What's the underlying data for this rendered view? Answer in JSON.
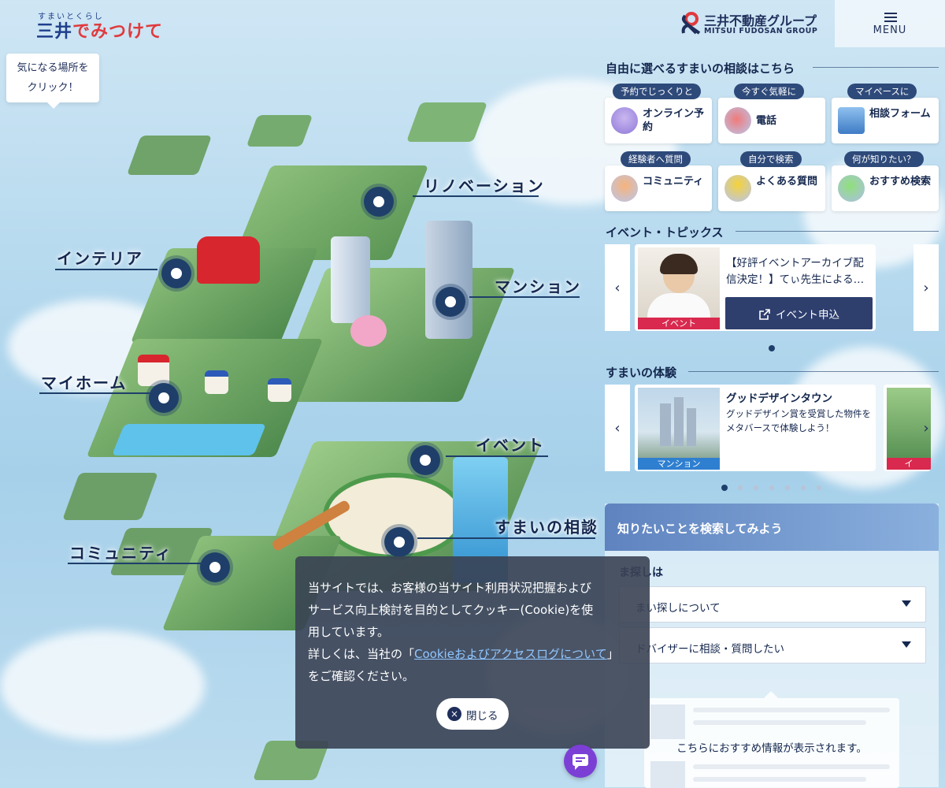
{
  "header": {
    "logo_sub": "すまいとくらし",
    "logo_main_blue": "三井",
    "logo_main_red": "でみつけて",
    "group_name_ja": "三井不動産グループ",
    "group_name_en": "MITSUI FUDOSAN GROUP",
    "menu_label": "MENU"
  },
  "hint": {
    "line1": "気になる場所を",
    "line2": "クリック！"
  },
  "map": {
    "areas": {
      "renovation": "リノベーション",
      "interior": "インテリア",
      "mansion": "マンション",
      "myhome": "マイホーム",
      "event": "イベント",
      "consult": "すまいの相談",
      "community": "コミュニティ"
    }
  },
  "consult": {
    "title": "自由に選べるすまいの相談はこちら",
    "items": [
      {
        "tag": "予約でじっくりと",
        "label": "オンライン予約",
        "icon": "online-reservation-icon"
      },
      {
        "tag": "今すぐ気軽に",
        "label": "電話",
        "icon": "phone-icon"
      },
      {
        "tag": "マイペースに",
        "label": "相談フォーム",
        "icon": "form-icon"
      },
      {
        "tag": "経験者へ質問",
        "label": "コミュニティ",
        "icon": "community-icon"
      },
      {
        "tag": "自分で検索",
        "label": "よくある質問",
        "icon": "faq-icon"
      },
      {
        "tag": "何が知りたい？",
        "label": "おすすめ検索",
        "icon": "recommend-search-icon"
      }
    ]
  },
  "events": {
    "title": "イベント・トピックス",
    "card": {
      "badge": "イベント",
      "title": "【好評イベントアーカイブ配信決定！】てぃ先生による…",
      "apply_label": "イベント申込"
    }
  },
  "experience": {
    "title": "すまいの体験",
    "card": {
      "title": "グッドデザインタウン",
      "desc": "グッドデザイン賞を受賞した物件をメタバースで体験しよう！",
      "badge": "マンション"
    },
    "peek_badge": "イ"
  },
  "search": {
    "title": "知りたいことを検索してみよう",
    "subtitle": "ま探しは",
    "selects": [
      {
        "value": "まい探しについて"
      },
      {
        "value": "ドバイザーに相談・質問したい"
      }
    ],
    "recommend_text": "こちらにおすすめ情報が表示されます。"
  },
  "cookie": {
    "line1": "当サイトでは、お客様の当サイト利用状況把握および",
    "line2": "サービス向上検討を目的としてクッキー(Cookie)を使",
    "line3": "用しています。",
    "line4_pre": "詳しくは、当社の「",
    "link": "Cookieおよびアクセスログについて",
    "line4_post": "」",
    "line5": "をご確認ください。",
    "close_label": "閉じる",
    "close_glyph": "×"
  },
  "arrows": {
    "prev": "‹",
    "next": "›"
  },
  "colors": {
    "navy": "#1f3f6a",
    "accent_red": "#d9294e",
    "chat_purple": "#7b3fd6"
  }
}
